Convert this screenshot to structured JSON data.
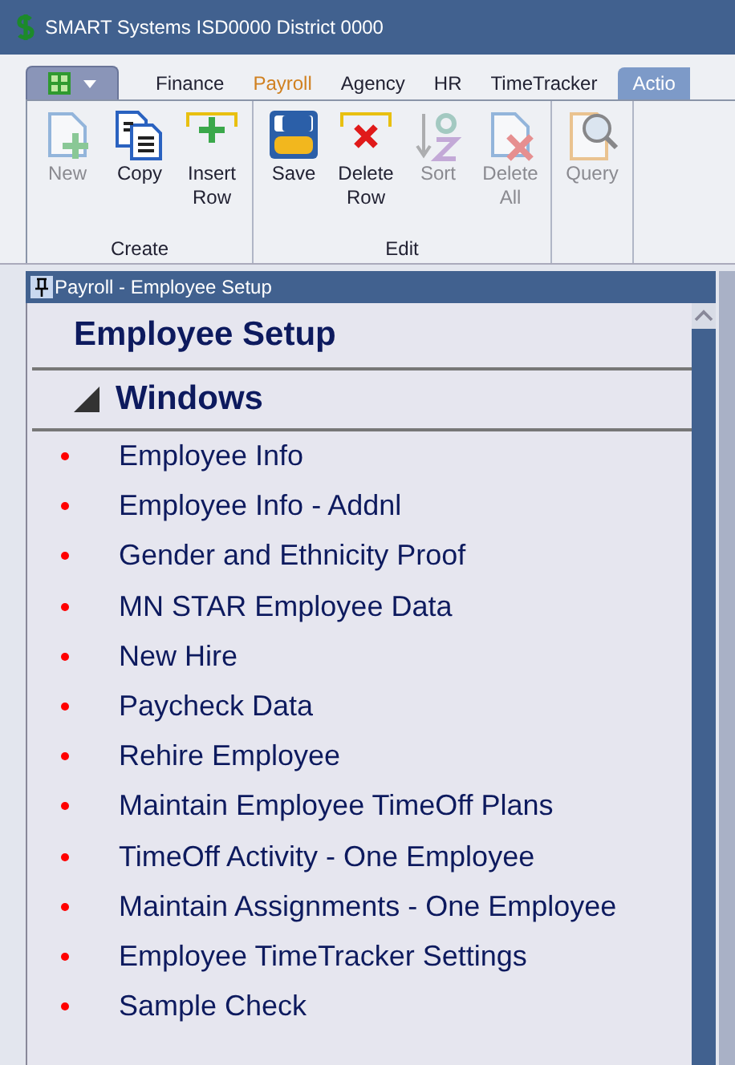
{
  "window": {
    "title": "SMART Systems  ISD0000 District 0000"
  },
  "tabs": [
    {
      "label": "Finance",
      "selected": false,
      "current": false
    },
    {
      "label": "Payroll",
      "selected": false,
      "current": true
    },
    {
      "label": "Agency",
      "selected": false,
      "current": false
    },
    {
      "label": "HR",
      "selected": false,
      "current": false
    },
    {
      "label": "TimeTracker",
      "selected": false,
      "current": false
    },
    {
      "label": "Actio",
      "selected": true,
      "current": false
    }
  ],
  "ribbon_groups": [
    {
      "label": "Create",
      "buttons": [
        {
          "label": "New",
          "kind": "new",
          "disabled": true
        },
        {
          "label": "Copy",
          "kind": "copy",
          "disabled": false
        },
        {
          "label": "Insert Row",
          "kind": "insert",
          "disabled": false
        }
      ]
    },
    {
      "label": "Edit",
      "buttons": [
        {
          "label": "Save",
          "kind": "save",
          "disabled": false
        },
        {
          "label": "Delete Row",
          "kind": "deleterow",
          "disabled": false
        },
        {
          "label": "Sort",
          "kind": "sort",
          "disabled": true
        },
        {
          "label": "Delete All",
          "kind": "deleteall",
          "disabled": true
        }
      ]
    },
    {
      "buttons": [
        {
          "label": "Query",
          "kind": "query",
          "disabled": true
        }
      ]
    }
  ],
  "panel": {
    "title": "Payroll - Employee Setup",
    "heading": "Employee Setup",
    "section": {
      "label": "Windows",
      "expanded": true
    },
    "items": [
      "Employee Info",
      "Employee Info - Addnl",
      "Gender and Ethnicity Proof",
      "MN STAR Employee Data",
      "New Hire",
      "Paycheck Data",
      "Rehire Employee",
      "Maintain Employee TimeOff Plans",
      "TimeOff Activity - One Employee",
      "Maintain Assignments - One Employee",
      "Employee TimeTracker Settings",
      "Sample Check"
    ]
  }
}
